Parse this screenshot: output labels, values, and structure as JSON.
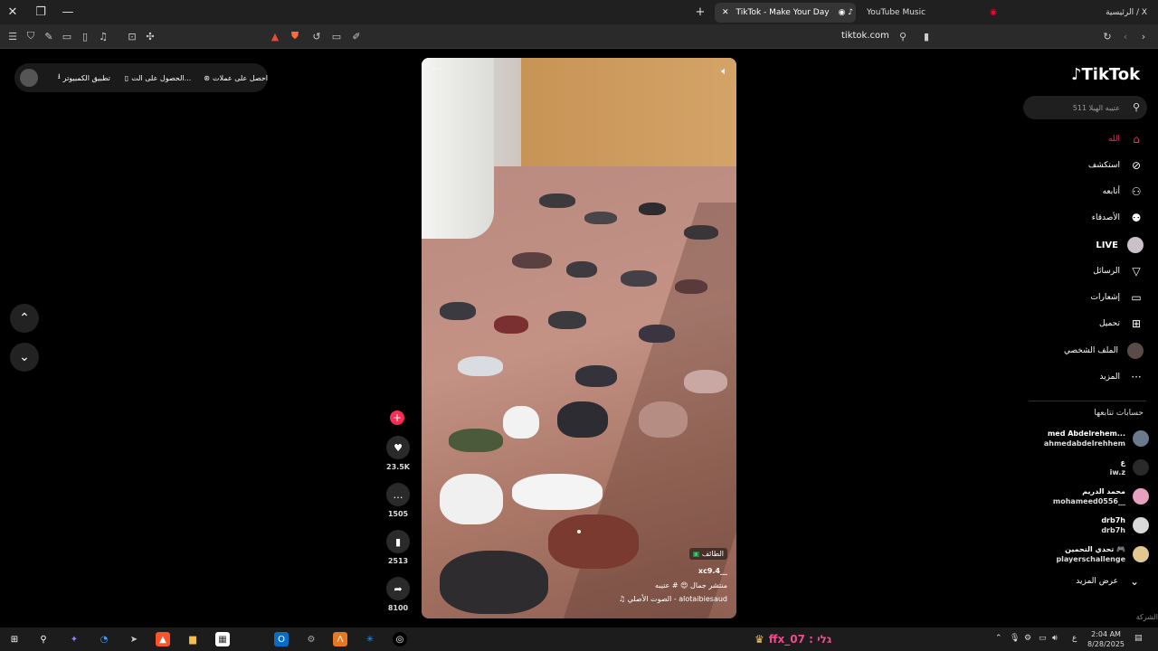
{
  "browser": {
    "tabs": [
      {
        "label": "TikTok - Make Your Day",
        "active": true
      },
      {
        "label": "YouTube Music",
        "active": false
      },
      {
        "label": "الرئيسية / X",
        "active": false
      }
    ],
    "url": "tiktok.com"
  },
  "top_pill": {
    "coins": "احصل على عملات",
    "get_app": "الحصول على الت...",
    "desktop_app": "تطبيق الكمبيوتر"
  },
  "video": {
    "location_badge": "الطائف",
    "username_tag": "xc9.4__",
    "caption": "منتشر جمال 😍 # عتيبه",
    "sound": "الصوت الأصلي - alotaibiesaud"
  },
  "actions": {
    "likes": "23.5K",
    "comments": "1505",
    "saves": "2513",
    "shares": "8100"
  },
  "sidebar": {
    "logo": "TikTok",
    "search_placeholder": "عتيبه الهيلا 511",
    "items": [
      {
        "label": "الله",
        "icon": "home-icon"
      },
      {
        "label": "استكشف",
        "icon": "compass-icon"
      },
      {
        "label": "أتابعه",
        "icon": "user-follow-icon"
      },
      {
        "label": "الأصدقاء",
        "icon": "friends-icon"
      },
      {
        "label": "LIVE",
        "icon": "live-icon"
      },
      {
        "label": "الرسائل",
        "icon": "messages-icon"
      },
      {
        "label": "إشعارات",
        "icon": "notifications-icon"
      },
      {
        "label": "تحميل",
        "icon": "upload-icon"
      },
      {
        "label": "الملف الشخصي",
        "icon": "profile-icon"
      },
      {
        "label": "المزيد",
        "icon": "more-icon"
      }
    ],
    "following_title": "حسابات تتابعها",
    "following": [
      {
        "name": "med Abdelrehem...",
        "handle": "ahmedabdelrehhem"
      },
      {
        "name": "ع",
        "handle": "iw.z"
      },
      {
        "name": "محمد الدريم",
        "handle": "mohameed0556__"
      },
      {
        "name": "drb7h",
        "handle": "drb7h"
      },
      {
        "name": "تحدي التحمين 🎮",
        "handle": "playerschallenge"
      }
    ],
    "see_more": "عرض المزيد",
    "footer_company": "الشركة"
  },
  "taskbar": {
    "stream_label": "ffx_07 : גלי",
    "time": "2:04 AM",
    "date": "8/28/2025",
    "lang": "ع"
  },
  "colors": {
    "accent": "#fe2c55",
    "page_bg": "#000000"
  }
}
